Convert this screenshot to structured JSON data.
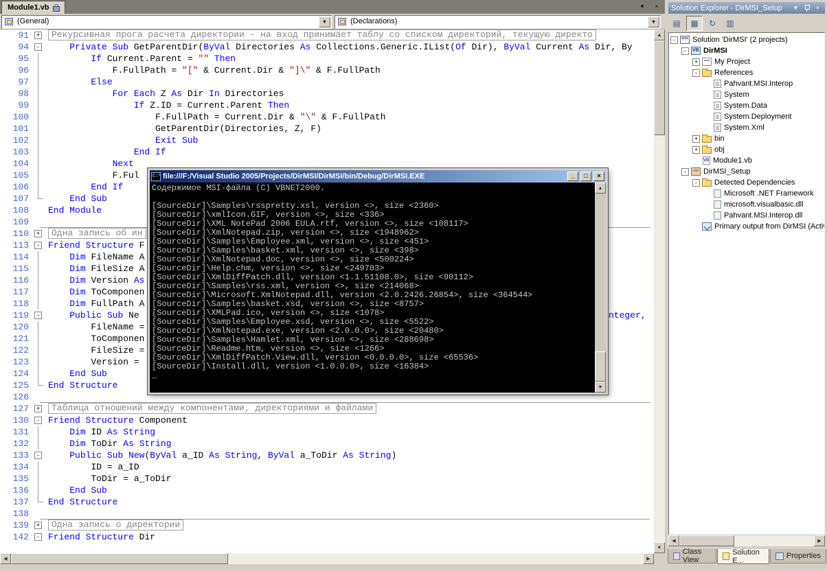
{
  "editor": {
    "tab_label": "Module1.vb",
    "doc_list_glyph": "▼",
    "doc_close_glyph": "×",
    "chevron_glyph": "▼",
    "combo_objects": "(General)",
    "combo_procedures": "(Declarations)",
    "lines": [
      {
        "n": 91,
        "fold": "+",
        "box": true,
        "text": "Рекурсивная прога расчета директории - на вход принимает таблу со списком директорий, текущую директо"
      },
      {
        "n": 94,
        "fold": "-",
        "text": "    Private Sub GetParentDir(ByVal Directories As Collections.Generic.IList(Of Dir), ByVal Current As Dir, By"
      },
      {
        "n": 95,
        "g": 1,
        "text": "        If Current.Parent = \"\" Then"
      },
      {
        "n": 96,
        "g": 1,
        "text": "            F.FullPath = \"[\" & Current.Dir & \"]\\\" & F.FullPath"
      },
      {
        "n": 97,
        "g": 1,
        "text": "        Else"
      },
      {
        "n": 98,
        "g": 1,
        "text": "            For Each Z As Dir In Directories"
      },
      {
        "n": 99,
        "g": 1,
        "text": "                If Z.ID = Current.Parent Then"
      },
      {
        "n": 100,
        "g": 1,
        "text": "                    F.FullPath = Current.Dir & \"\\\" & F.FullPath"
      },
      {
        "n": 101,
        "g": 1,
        "text": "                    GetParentDir(Directories, Z, F)"
      },
      {
        "n": 102,
        "g": 1,
        "text": "                    Exit Sub"
      },
      {
        "n": 103,
        "g": 1,
        "text": "                End If"
      },
      {
        "n": 104,
        "g": 1,
        "text": "            Next"
      },
      {
        "n": 105,
        "g": 1,
        "text": "            F.Ful"
      },
      {
        "n": 106,
        "g": 1,
        "text": "        End If"
      },
      {
        "n": 107,
        "g": 2,
        "text": "    End Sub"
      },
      {
        "n": 108,
        "text": "End Module"
      },
      {
        "n": 109,
        "hr": true,
        "text": ""
      },
      {
        "n": 110,
        "fold": "+",
        "box": true,
        "text": "Одна запись об ин"
      },
      {
        "n": 113,
        "fold": "-",
        "text": "Friend Structure F"
      },
      {
        "n": 114,
        "g": 1,
        "text": "    Dim FileName A"
      },
      {
        "n": 115,
        "g": 1,
        "text": "    Dim FileSize A"
      },
      {
        "n": 116,
        "g": 1,
        "text": "    Dim Version As"
      },
      {
        "n": 117,
        "g": 1,
        "text": "    Dim ToComponen"
      },
      {
        "n": 118,
        "g": 1,
        "text": "    Dim FullPath A"
      },
      {
        "n": 119,
        "fold": "-",
        "text": "    Public Sub Ne",
        "right": "nteger,"
      },
      {
        "n": 120,
        "g": 1,
        "text": "        FileName ="
      },
      {
        "n": 121,
        "g": 1,
        "text": "        ToComponen"
      },
      {
        "n": 122,
        "g": 1,
        "text": "        FileSize ="
      },
      {
        "n": 123,
        "g": 1,
        "text": "        Version = "
      },
      {
        "n": 124,
        "g": 1,
        "text": "    End Sub"
      },
      {
        "n": 125,
        "g": 2,
        "text": "End Structure"
      },
      {
        "n": 126,
        "hr": true,
        "text": ""
      },
      {
        "n": 127,
        "fold": "+",
        "box": true,
        "text": "Таблица отношений между компонентами, директориями и файлами"
      },
      {
        "n": 130,
        "fold": "-",
        "text": "Friend Structure Component"
      },
      {
        "n": 131,
        "g": 1,
        "text": "    Dim ID As String"
      },
      {
        "n": 132,
        "g": 1,
        "text": "    Dim ToDir As String"
      },
      {
        "n": 133,
        "fold": "-",
        "text": "    Public Sub New(ByVal a_ID As String, ByVal a_ToDir As String)"
      },
      {
        "n": 134,
        "g": 1,
        "text": "        ID = a_ID"
      },
      {
        "n": 135,
        "g": 1,
        "text": "        ToDir = a_ToDir"
      },
      {
        "n": 136,
        "g": 1,
        "text": "    End Sub"
      },
      {
        "n": 137,
        "g": 2,
        "text": "End Structure"
      },
      {
        "n": 138,
        "hr": true,
        "text": ""
      },
      {
        "n": 139,
        "fold": "+",
        "box": true,
        "text": "Одна запись о директории"
      },
      {
        "n": 142,
        "fold": "-",
        "text": "Friend Structure Dir"
      }
    ]
  },
  "console": {
    "title": "file:///F:/Visual Studio 2005/Projects/DirMSI/DirMSI/bin/Debug/DirMSI.EXE",
    "icon_label": "C:\\",
    "buttons": {
      "minimize": "_",
      "maximize": "□",
      "close": "×"
    },
    "lines": [
      "Содержимое MSI-файла (C) VBNET2000.",
      "",
      "[SourceDir]\\Samples\\rsspretty.xsl, version <>, size <2360>",
      "[SourceDir]\\xmlIcon.GIF, version <>, size <336>",
      "[SourceDir]\\XML NotePad 2006 EULA.rtf, version <>, size <108117>",
      "[SourceDir]\\XmlNotepad.zip, version <>, size <1948962>",
      "[SourceDir]\\Samples\\Employee.xml, version <>, size <451>",
      "[SourceDir]\\Samples\\basket.xml, version <>, size <398>",
      "[SourceDir]\\XmlNotepad.doc, version <>, size <500224>",
      "[SourceDir]\\Help.chm, version <>, size <249703>",
      "[SourceDir]\\XmlDiffPatch.dll, version <1.1.51108.0>, size <90112>",
      "[SourceDir]\\Samples\\rss.xml, version <>, size <214068>",
      "[SourceDir]\\Microsoft.XmlNotepad.dll, version <2.0.2426.26854>, size <364544>",
      "[SourceDir]\\Samples\\basket.xsd, version <>, size <8757>",
      "[SourceDir]\\XMLPad.ico, version <>, size <1078>",
      "[SourceDir]\\Samples\\Employee.xsd, version <>, size <5522>",
      "[SourceDir]\\XmlNotepad.exe, version <2.0.0.0>, size <20480>",
      "[SourceDir]\\Samples\\Hamlet.xml, version <>, size <288698>",
      "[SourceDir]\\Readme.htm, version <>, size <1266>",
      "[SourceDir]\\XmlDiffPatch.View.dll, version <0.0.0.0>, size <65536>",
      "[SourceDir]\\Install.dll, version <1.0.0.0>, size <16384>"
    ],
    "cursor": "_"
  },
  "solution_explorer": {
    "title": "Solution Explorer - DirMSI_Setup",
    "buttons": {
      "menu": "▼",
      "close": "×"
    },
    "toolbar": [
      {
        "name": "properties",
        "glyph": "▤",
        "pressed": false
      },
      {
        "name": "show-all-files",
        "glyph": "▦",
        "pressed": true
      },
      {
        "name": "refresh",
        "glyph": "↻",
        "pressed": false
      },
      {
        "name": "view-class-diagram",
        "glyph": "▥",
        "pressed": false
      }
    ],
    "tree": [
      {
        "label": "Solution 'DirMSI' (2 projects)",
        "indent": 0,
        "expand": "-",
        "icon": "solution"
      },
      {
        "label": "DirMSI",
        "indent": 1,
        "expand": "-",
        "icon": "vb-project",
        "bold": true
      },
      {
        "label": "My Project",
        "indent": 2,
        "expand": "+",
        "icon": "my-project"
      },
      {
        "label": "References",
        "indent": 2,
        "expand": "-",
        "icon": "folder"
      },
      {
        "label": "Pahvant.MSI.Interop",
        "indent": 3,
        "icon": "reference"
      },
      {
        "label": "System",
        "indent": 3,
        "icon": "reference"
      },
      {
        "label": "System.Data",
        "indent": 3,
        "icon": "reference"
      },
      {
        "label": "System.Deployment",
        "indent": 3,
        "icon": "reference"
      },
      {
        "label": "System.Xml",
        "indent": 3,
        "icon": "reference"
      },
      {
        "label": "bin",
        "indent": 2,
        "expand": "+",
        "icon": "folder"
      },
      {
        "label": "obj",
        "indent": 2,
        "expand": "+",
        "icon": "folder"
      },
      {
        "label": "Module1.vb",
        "indent": 2,
        "icon": "vb-file"
      },
      {
        "label": "DirMSI_Setup",
        "indent": 1,
        "expand": "-",
        "icon": "setup-project"
      },
      {
        "label": "Detected Dependencies",
        "indent": 2,
        "expand": "-",
        "icon": "folder"
      },
      {
        "label": "Microsoft .NET Framework",
        "indent": 3,
        "icon": "dependency"
      },
      {
        "label": "microsoft.visualbasic.dll",
        "indent": 3,
        "icon": "dependency"
      },
      {
        "label": "Pahvant.MSI.Interop.dll",
        "indent": 3,
        "icon": "dependency"
      },
      {
        "label": "Primary output from DirMSI (Activ",
        "indent": 2,
        "icon": "output"
      }
    ]
  },
  "panel_tabs": [
    {
      "label": "Class View",
      "icon": "class-view",
      "active": false
    },
    {
      "label": "Solution E...",
      "icon": "solution-explorer",
      "active": true
    },
    {
      "label": "Properties",
      "icon": "properties",
      "active": false
    }
  ],
  "scrollbar_glyphs": {
    "up": "▲",
    "down": "▼",
    "left": "◀",
    "right": "▶"
  }
}
